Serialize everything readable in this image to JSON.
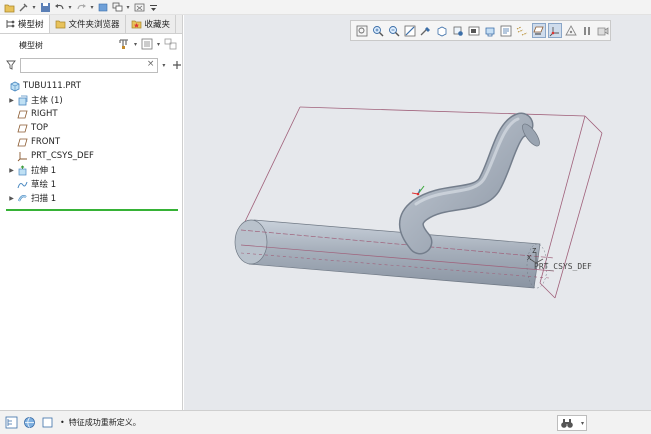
{
  "tabs": [
    {
      "label": "模型树",
      "icon": "model-tree-icon"
    },
    {
      "label": "文件夹浏览器",
      "icon": "folder-icon"
    },
    {
      "label": "收藏夹",
      "icon": "favorites-icon"
    }
  ],
  "tree_header": {
    "title": "模型树"
  },
  "filter": {
    "value": "",
    "clear": "×"
  },
  "tree": [
    {
      "label": "TUBU111.PRT",
      "expand": "",
      "icon": "part-icon"
    },
    {
      "label": "主体 (1)",
      "expand": "▶",
      "icon": "body-icon"
    },
    {
      "label": "RIGHT",
      "expand": "",
      "icon": "datum-plane-icon"
    },
    {
      "label": "TOP",
      "expand": "",
      "icon": "datum-plane-icon"
    },
    {
      "label": "FRONT",
      "expand": "",
      "icon": "datum-plane-icon"
    },
    {
      "label": "PRT_CSYS_DEF",
      "expand": "",
      "icon": "csys-icon"
    },
    {
      "label": "拉伸 1",
      "expand": "▶",
      "icon": "extrude-icon"
    },
    {
      "label": "草绘 1",
      "expand": "",
      "icon": "sketch-icon"
    },
    {
      "label": "扫描 1",
      "expand": "▶",
      "icon": "sweep-icon"
    }
  ],
  "graphics": {
    "csys_label": "PRT_CSYS_DEF",
    "csys_axes": {
      "x": "X",
      "z": "Z"
    }
  },
  "status": {
    "bullet": "•",
    "message": "特征成功重新定义。"
  },
  "colors": {
    "accent_green": "#36b236",
    "graphics_bg": "#e6e8ec",
    "datum_plane": "#a0607a",
    "solid": "#a8b2be"
  }
}
